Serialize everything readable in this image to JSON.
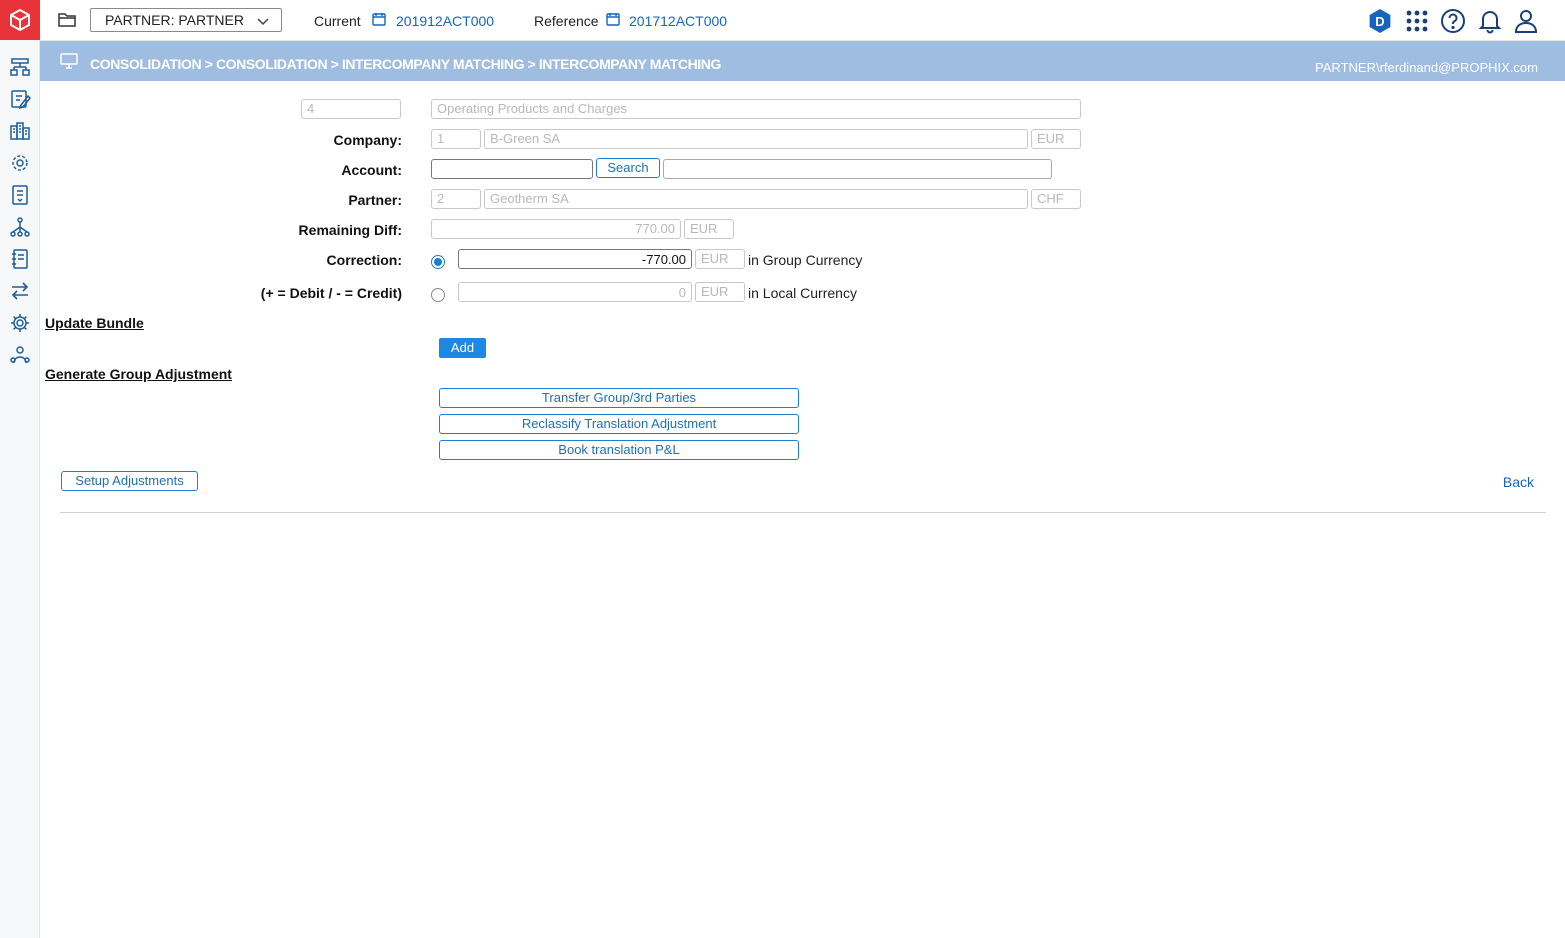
{
  "topbar": {
    "partner_select": "PARTNER: PARTNER",
    "current_label": "Current",
    "current_value": "201912ACT000",
    "reference_label": "Reference",
    "reference_value": "201712ACT000",
    "d_badge": "D"
  },
  "header": {
    "breadcrumb": "CONSOLIDATION > CONSOLIDATION > INTERCOMPANY MATCHING > INTERCOMPANY MATCHING",
    "user": "PARTNER\\rferdinand@PROPHIX.com"
  },
  "form": {
    "row0": {
      "code": "4",
      "description": "Operating Products and Charges"
    },
    "company": {
      "label": "Company:",
      "code": "1",
      "name": "B-Green SA",
      "currency": "EUR"
    },
    "account": {
      "label": "Account:",
      "value": "",
      "search_label": "Search",
      "description": ""
    },
    "partner": {
      "label": "Partner:",
      "code": "2",
      "name": "Geotherm SA",
      "currency": "CHF"
    },
    "remaining": {
      "label": "Remaining Diff:",
      "value": "770.00",
      "currency": "EUR"
    },
    "correction": {
      "label": "Correction:",
      "value": "-770.00",
      "currency": "EUR",
      "suffix": "in Group Currency",
      "selected": true
    },
    "local": {
      "label": "(+ = Debit / - = Credit)",
      "value": "0",
      "currency": "EUR",
      "suffix": "in Local Currency",
      "selected": false
    }
  },
  "actions": {
    "update_bundle": "Update Bundle",
    "add": "Add",
    "generate_group_adjustment": "Generate Group Adjustment",
    "transfer": "Transfer Group/3rd Parties",
    "reclassify": "Reclassify Translation Adjustment",
    "book": "Book translation P&L",
    "setup": "Setup Adjustments",
    "back": "Back"
  },
  "colors": {
    "accent": "#1e88e5",
    "header_bar": "#9ebde0",
    "logo": "#e8333b",
    "badge": "#1565c0"
  }
}
